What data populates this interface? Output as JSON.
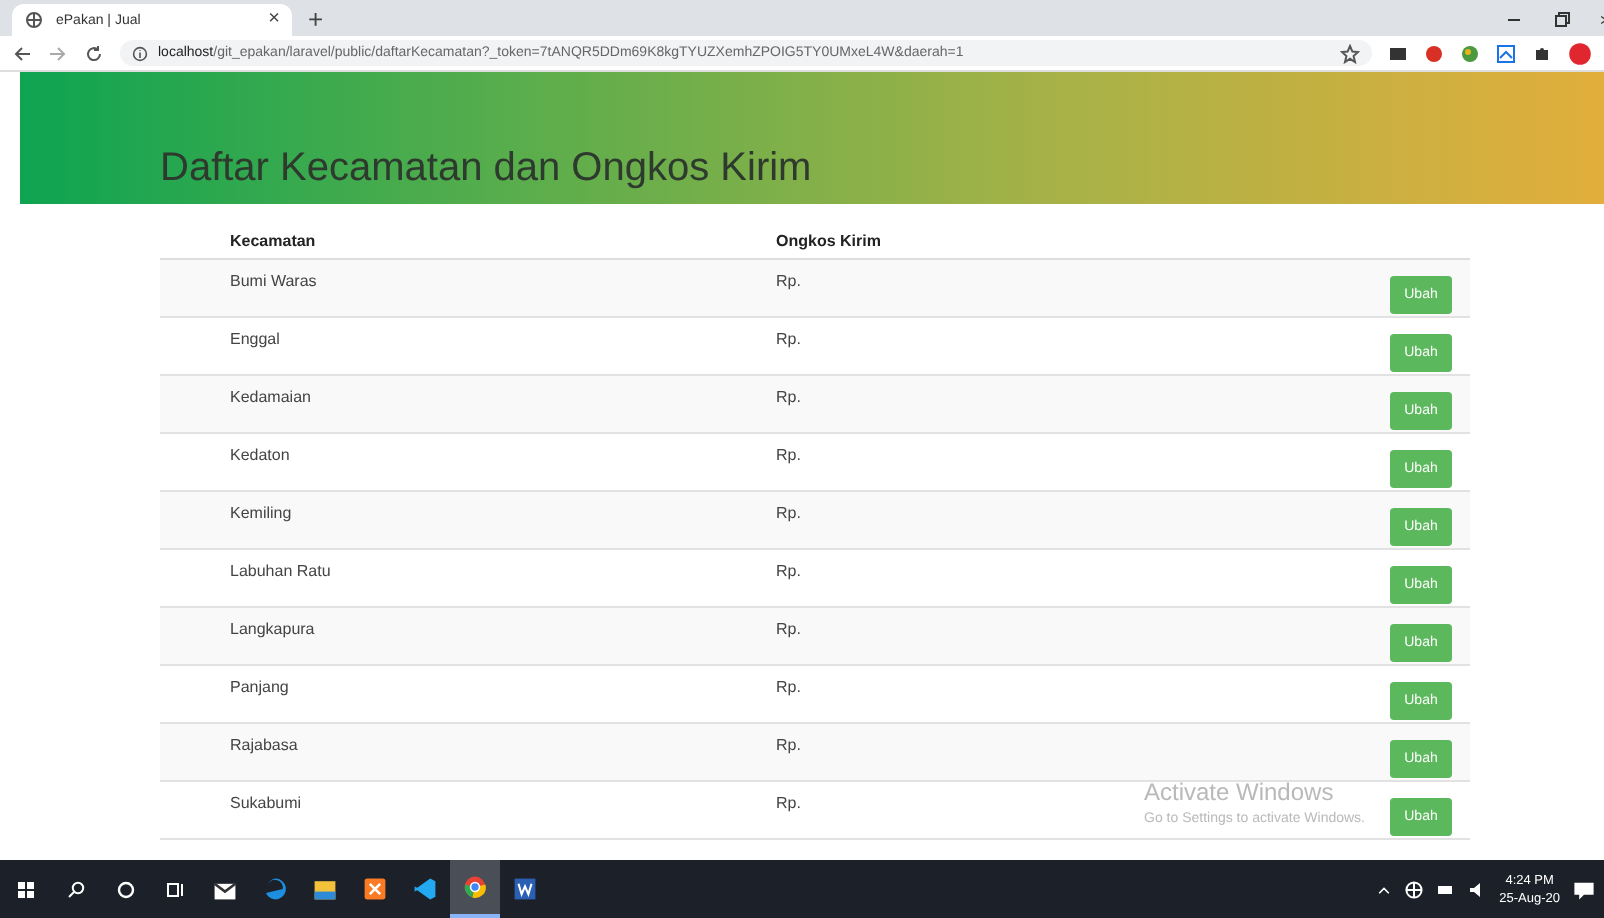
{
  "browser": {
    "tab": {
      "title": "ePakan | Jual",
      "close": "×",
      "new_tab": "+"
    },
    "url": {
      "host": "localhost",
      "path": "/git_epakan/laravel/public/daftarKecamatan?_token=7tANQR5DDm69K8kgTYUZXemhZPOIG5TY0UMxeL4W&daerah=1"
    }
  },
  "page": {
    "title": "Daftar Kecamatan dan Ongkos Kirim",
    "columns": [
      "Kecamatan",
      "Ongkos Kirim"
    ],
    "rows": [
      {
        "kecamatan": "Bumi Waras",
        "ongkos": "Rp.",
        "action": "Ubah"
      },
      {
        "kecamatan": "Enggal",
        "ongkos": "Rp.",
        "action": "Ubah"
      },
      {
        "kecamatan": "Kedamaian",
        "ongkos": "Rp.",
        "action": "Ubah"
      },
      {
        "kecamatan": "Kedaton",
        "ongkos": "Rp.",
        "action": "Ubah"
      },
      {
        "kecamatan": "Kemiling",
        "ongkos": "Rp.",
        "action": "Ubah"
      },
      {
        "kecamatan": "Labuhan Ratu",
        "ongkos": "Rp.",
        "action": "Ubah"
      },
      {
        "kecamatan": "Langkapura",
        "ongkos": "Rp.",
        "action": "Ubah"
      },
      {
        "kecamatan": "Panjang",
        "ongkos": "Rp.",
        "action": "Ubah"
      },
      {
        "kecamatan": "Rajabasa",
        "ongkos": "Rp.",
        "action": "Ubah"
      },
      {
        "kecamatan": "Sukabumi",
        "ongkos": "Rp.",
        "action": "Ubah"
      }
    ]
  },
  "os_notice": {
    "title": "Activate Windows",
    "text": "Go to Settings to activate Windows."
  },
  "taskbar": {
    "apps": [
      {
        "kind": "mail",
        "selected": false
      },
      {
        "kind": "edge",
        "selected": false
      },
      {
        "kind": "explorer",
        "selected": false
      },
      {
        "kind": "xampp",
        "selected": false
      },
      {
        "kind": "vscode",
        "selected": false
      },
      {
        "kind": "chrome",
        "selected": true
      },
      {
        "kind": "word",
        "selected": false
      }
    ],
    "clock": {
      "time": "4:24 PM",
      "date": "25-Aug-20"
    }
  }
}
